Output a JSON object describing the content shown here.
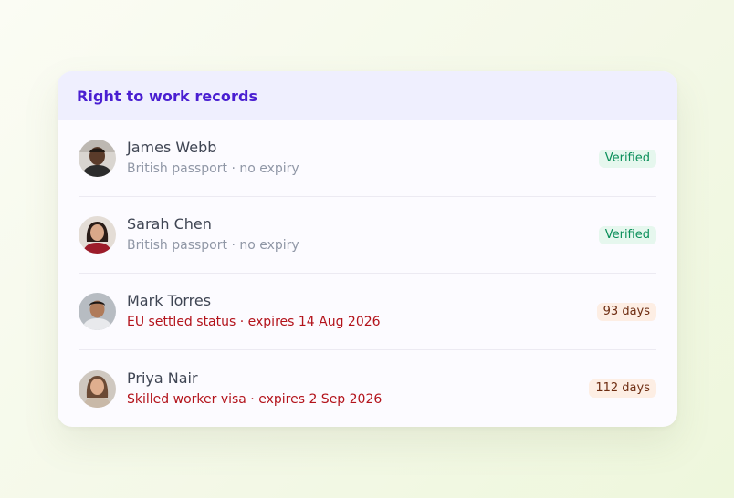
{
  "panel": {
    "title": "Right to work records"
  },
  "records": [
    {
      "name": "James Webb",
      "document": "British passport · no expiry",
      "badge": "Verified",
      "status": "verified",
      "avatar": "avatar-photo"
    },
    {
      "name": "Sarah Chen",
      "document": "British passport · no expiry",
      "badge": "Verified",
      "status": "verified",
      "avatar": "avatar-photo"
    },
    {
      "name": "Mark Torres",
      "document": "EU settled status · expires 14 Aug 2026",
      "badge": "93 days",
      "status": "expiring",
      "avatar": "avatar-photo"
    },
    {
      "name": "Priya Nair",
      "document": "Skilled worker visa · expires 2 Sep 2026",
      "badge": "112 days",
      "status": "expiring",
      "avatar": "avatar-photo"
    }
  ],
  "colors": {
    "title": "#4a1fd1",
    "verified_badge_bg": "#e6f7ee",
    "verified_badge_text": "#0b8f5a",
    "expiry_text": "#b3131b",
    "days_badge_bg": "#fdeee4",
    "days_badge_text": "#6e2d12"
  }
}
